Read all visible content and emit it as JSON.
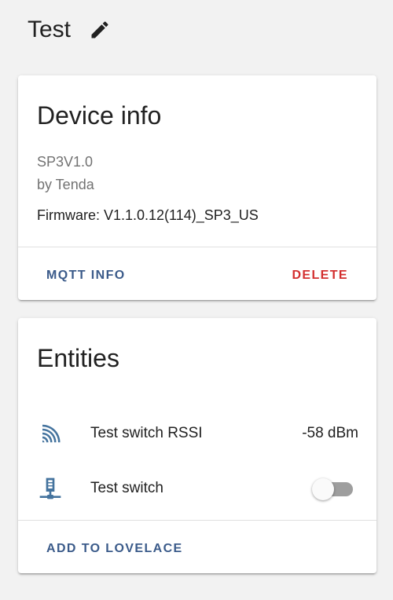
{
  "header": {
    "title": "Test",
    "edit_icon": "pencil-icon"
  },
  "device_card": {
    "title": "Device info",
    "model": "SP3V1.0",
    "manufacturer": "by Tenda",
    "firmware": "Firmware: V1.1.0.12(114)_SP3_US",
    "mqtt_label": "MQTT INFO",
    "delete_label": "DELETE"
  },
  "entities_card": {
    "title": "Entities",
    "rows": [
      {
        "icon": "wifi-signal-icon",
        "name": "Test switch RSSI",
        "state": "-58 dBm"
      },
      {
        "icon": "network-server-icon",
        "name": "Test switch",
        "toggle_on": false
      }
    ],
    "add_label": "ADD TO LOVELACE"
  },
  "colors": {
    "accent": "#3b5b8a",
    "danger": "#d32f2f",
    "icon": "#44739e",
    "background": "#f2f2f2"
  }
}
